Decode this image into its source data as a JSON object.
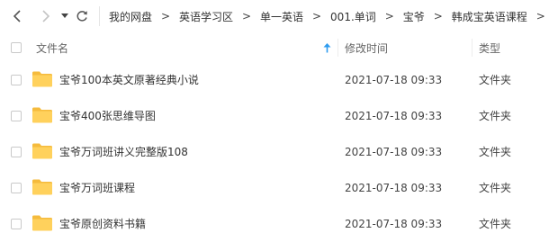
{
  "toolbar": {
    "back_icon": "chevron-left-icon",
    "forward_icon": "chevron-right-icon",
    "history_icon": "caret-down-icon",
    "refresh_icon": "refresh-icon"
  },
  "breadcrumb": {
    "items": [
      "我的网盘",
      "英语学习区",
      "单一英语",
      "001.单词",
      "宝爷",
      "韩成宝英语课程"
    ],
    "separator": ">"
  },
  "columns": {
    "name": "文件名",
    "modified": "修改时间",
    "type": "类型",
    "sort_icon": "arrow-up-icon"
  },
  "files": [
    {
      "name": "宝爷100本英文原著经典小说",
      "modified": "2021-07-18 09:33",
      "type": "文件夹"
    },
    {
      "name": "宝爷400张思维导图",
      "modified": "2021-07-18 09:33",
      "type": "文件夹"
    },
    {
      "name": "宝爷万词班讲义完整版108",
      "modified": "2021-07-18 09:33",
      "type": "文件夹"
    },
    {
      "name": "宝爷万词班课程",
      "modified": "2021-07-18 09:33",
      "type": "文件夹"
    },
    {
      "name": "宝爷原创资料书籍",
      "modified": "2021-07-18 09:33",
      "type": "文件夹"
    }
  ],
  "colors": {
    "folder": "#ffd15c",
    "folder_back": "#f5bb3d",
    "sort_accent": "#2c9bf0"
  }
}
